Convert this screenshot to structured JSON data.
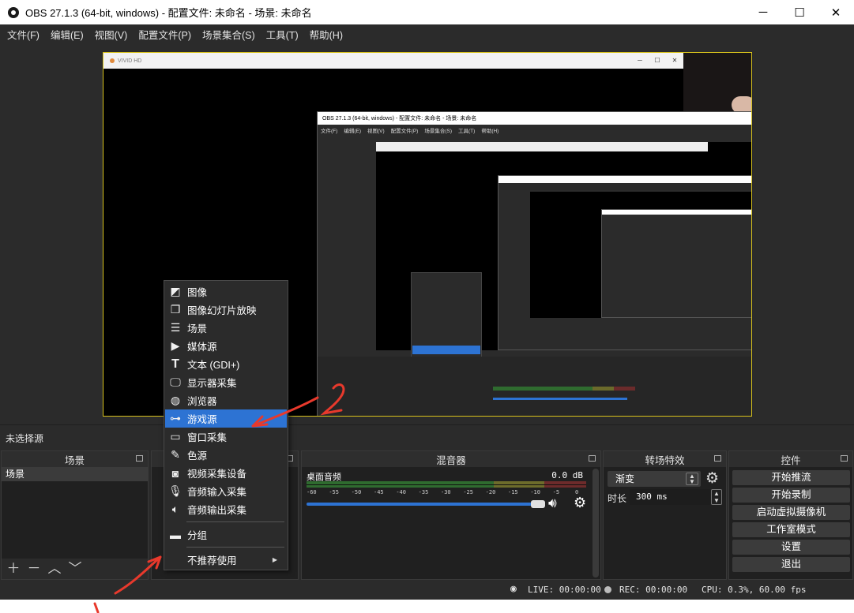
{
  "window": {
    "title": "OBS 27.1.3 (64-bit, windows) - 配置文件: 未命名 - 场景: 未命名",
    "minimize": "─",
    "maximize": "☐",
    "close": "✕"
  },
  "menu": [
    "文件(F)",
    "编辑(E)",
    "视图(V)",
    "配置文件(P)",
    "场景集合(S)",
    "工具(T)",
    "帮助(H)"
  ],
  "preview": {
    "vivid_title": "VIVID HD",
    "nested_title": "OBS 27.1.3 (64-bit, windows) - 配置文件: 未命名 - 场景: 未命名",
    "nested_menu": [
      "文件(F)",
      "编辑(E)",
      "视图(V)",
      "配置文件(P)",
      "场景集合(S)",
      "工具(T)",
      "帮助(H)"
    ]
  },
  "no_source_selected": "未选择源",
  "scenes": {
    "title": "场景",
    "items": [
      "场景"
    ]
  },
  "mixer": {
    "title": "混音器",
    "channel": "桌面音频",
    "db": "0.0 dB",
    "ticks": [
      "-60",
      "-55",
      "-50",
      "-45",
      "-40",
      "-35",
      "-30",
      "-25",
      "-20",
      "-15",
      "-10",
      "-5",
      "0"
    ]
  },
  "transitions": {
    "title": "转场特效",
    "selected": "渐变",
    "duration_label": "时长",
    "duration_value": "300 ms"
  },
  "controls": {
    "title": "控件",
    "buttons": [
      "开始推流",
      "开始录制",
      "启动虚拟摄像机",
      "工作室模式",
      "设置",
      "退出"
    ]
  },
  "status": {
    "live": "LIVE: 00:00:00",
    "rec": "REC: 00:00:00",
    "cpu": "CPU: 0.3%, 60.00 fps"
  },
  "context_menu": {
    "items": [
      "图像",
      "图像幻灯片放映",
      "场景",
      "媒体源",
      "文本 (GDI+)",
      "显示器采集",
      "浏览器",
      "游戏源",
      "窗口采集",
      "色源",
      "视频采集设备",
      "音频输入采集",
      "音频输出采集"
    ],
    "highlighted_index": 7,
    "group": "分组",
    "deprecated": "不推荐使用"
  },
  "icons": {
    "add": "plus-icon",
    "remove": "minus-icon",
    "up": "chevron-up-icon",
    "down": "chevron-down-icon",
    "gear": "gear-icon",
    "volume": "speaker-icon"
  },
  "colors": {
    "highlight": "#2d73d3",
    "preview_border": "#d8c21c",
    "annotation": "#e8392c"
  }
}
